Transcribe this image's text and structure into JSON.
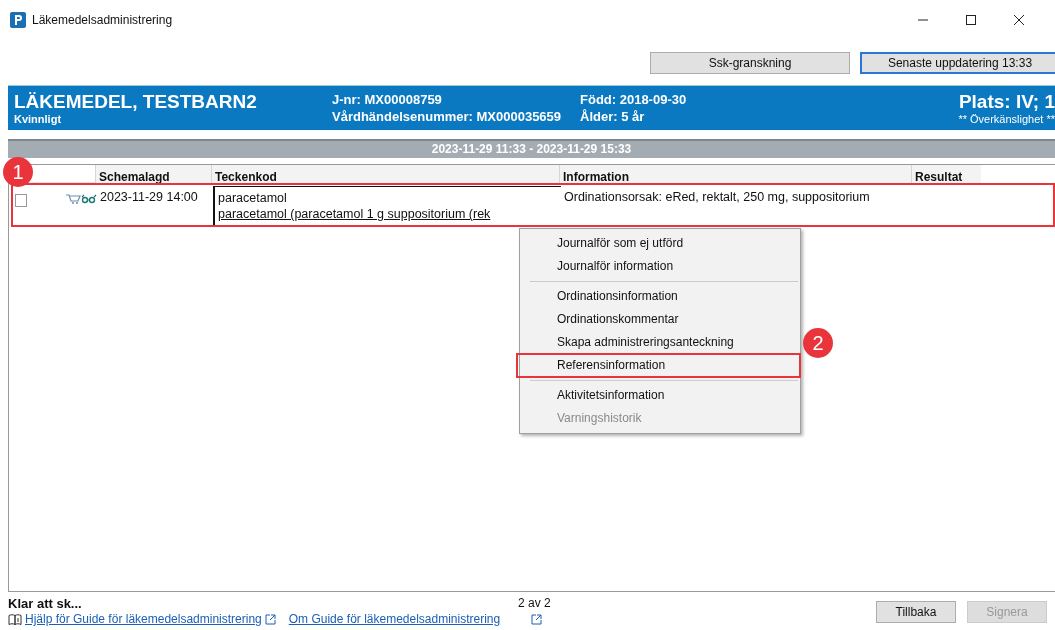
{
  "window": {
    "title": "Läkemedelsadministrering"
  },
  "top_buttons": [
    {
      "label": "Ssk-granskning",
      "focused": false
    },
    {
      "label": "Senaste uppdatering 13:33",
      "focused": true
    }
  ],
  "patient": {
    "name": "LÄKEMEDEL, TESTBARN2",
    "sex": "Kvinnligt",
    "jnr": "J-nr: MX00008759",
    "visit": "Vårdhändelsenummer: MX000035659",
    "born": "Född: 2018-09-30",
    "age": "Ålder: 5 år",
    "place": "Plats: IV; 1",
    "allergy": "** Överkänslighet **"
  },
  "period": "2023-11-29 11:33  - 2023-11-29 15:33",
  "table": {
    "columns": [
      "Schemalagd",
      "Teckenkod",
      "Information",
      "Resultat"
    ],
    "rows": [
      {
        "highlighted": true,
        "checked": false,
        "scheduled": "2023-11-29 14:00",
        "code": "paracetamol",
        "code_detail": "paracetamol (paracetamol 1 g suppositorium (rek",
        "information": "Ordinationsorsak: eRed, rektalt, 250 mg, suppositorium"
      }
    ]
  },
  "context_menu": [
    {
      "label": "Journalför som ej utförd",
      "disabled": false,
      "separator_before": false,
      "highlighted": false
    },
    {
      "label": "Journalför information",
      "disabled": false,
      "separator_before": false,
      "highlighted": false
    },
    {
      "label": "Ordinationsinformation",
      "disabled": false,
      "separator_before": true,
      "highlighted": false
    },
    {
      "label": "Ordinationskommentar",
      "disabled": false,
      "separator_before": false,
      "highlighted": false
    },
    {
      "label": "Skapa administreringsanteckning",
      "disabled": false,
      "separator_before": false,
      "highlighted": false
    },
    {
      "label": "Referensinformation",
      "disabled": false,
      "separator_before": false,
      "highlighted": true
    },
    {
      "label": "Aktivitetsinformation",
      "disabled": false,
      "separator_before": true,
      "highlighted": false
    },
    {
      "label": "Varningshistorik",
      "disabled": true,
      "separator_before": false,
      "highlighted": false
    }
  ],
  "annotations": [
    "1",
    "2"
  ],
  "status": {
    "text": "Klar att sk...",
    "page": "2 av 2"
  },
  "links": [
    "Hjälp för Guide för läkemedelsadministrering",
    "Om Guide för läkemedelsadministrering"
  ],
  "bottom_buttons": [
    {
      "label": "Tillbaka",
      "disabled": false
    },
    {
      "label": "Signera",
      "disabled": true
    }
  ]
}
